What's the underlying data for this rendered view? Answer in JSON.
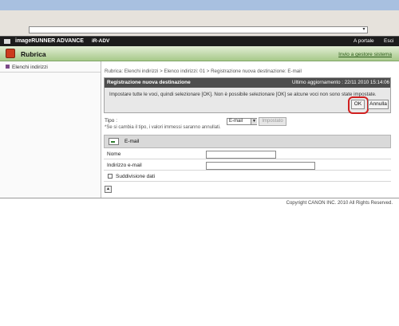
{
  "browser": {
    "address": "",
    "dropdown_glyph": "▾"
  },
  "header": {
    "brand": "imageRUNNER ADVANCE",
    "model": "iR-ADV",
    "link_portal": "A portale",
    "link_exit": "Esci"
  },
  "nav": {
    "title": "Rubrica",
    "link_send": "Invio a gestore sistema"
  },
  "sidebar": {
    "items": [
      {
        "label": "Elenchi indirizzi"
      }
    ]
  },
  "breadcrumb": "Rubrica: Elenchi indirizzi > Elenco indirizzi: 01 > Registrazione nuova destinazione: E-mail",
  "panel": {
    "title": "Registrazione nuova destinazione",
    "updated": "Ultimo aggiornamento : 22/11 2010 15:14:06",
    "message": "Impostare tutte le voci, quindi selezionare [OK]. Non è possibile selezionare [OK] se alcune voci non sono state impostate.",
    "ok_label": "OK",
    "cancel_label": "Annulla"
  },
  "type_section": {
    "label": "Tipo :",
    "note": "*Se si cambia il tipo, i valori immessi saranno annullati.",
    "selected": "E-mail",
    "apply_label": "Impostato"
  },
  "email_section": {
    "title": "E-mail",
    "name_label": "Nome",
    "name_value": "",
    "email_label": "Indirizzo e-mail",
    "email_value": "",
    "split_label": "Suddivisione dati",
    "split_checked": false,
    "top_glyph": "▲"
  },
  "footer": {
    "copyright": "Copyright CANON INC. 2010 All Rights Reserved."
  },
  "colors": {
    "accent_green": "#a7c98a",
    "ok_highlight": "#d02020",
    "header_dark": "#1c1c1c"
  }
}
